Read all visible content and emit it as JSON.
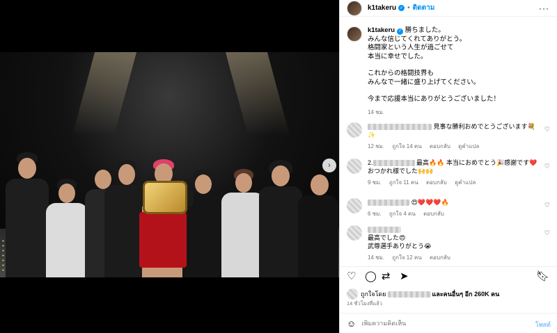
{
  "header": {
    "username": "k1takeru",
    "follow_label": "ติดตาม",
    "more_label": "···"
  },
  "caption": {
    "username": "k1takeru",
    "lines": [
      "勝ちました。",
      "みんな信じてくれてありがとう。",
      "格闘家という人生が過ごせて",
      "本当に幸せでした。",
      "",
      "これからの格闘技界も",
      "みんなで一緒に盛り上げてください。",
      "",
      "今まで応援本当にありがとうございました！"
    ],
    "time": "14 ชม."
  },
  "comments": [
    {
      "text": "見事な勝利おめでとうございます💐✨",
      "time": "12 ชม.",
      "likes": "ถูกใจ 14 คน",
      "reply": "ตอบกลับ",
      "translate": "ดูคำแปล"
    },
    {
      "text_prefix": "2.",
      "text": "本当におめでとう🎉感謝です❤️おつかれ様でした🙌🙌",
      "text_mid": "最高🔥🔥",
      "time": "9 ชม.",
      "likes": "ถูกใจ 11 คน",
      "reply": "ตอบกลับ",
      "translate": "ดูคำแปล"
    },
    {
      "text": "😍❤️❤️❤️🔥",
      "time": "6 ชม.",
      "likes": "ถูกใจ 4 คน",
      "reply": "ตอบกลับ"
    },
    {
      "text_lines": [
        "最高でした😍",
        "武尊選手ありがとう😭"
      ],
      "time": "14 ชม.",
      "likes": "ถูกใจ 12 คน",
      "reply": "ตอบกลับ"
    }
  ],
  "likes": {
    "prefix": "ถูกใจโดย",
    "suffix": "และคนอื่นๆ อีก 260K คน"
  },
  "timestamp": "14 ชั่วโมงที่แล้ว",
  "add_comment": {
    "placeholder": "เพิ่มความคิดเห็น",
    "post_label": "โพสต์"
  }
}
